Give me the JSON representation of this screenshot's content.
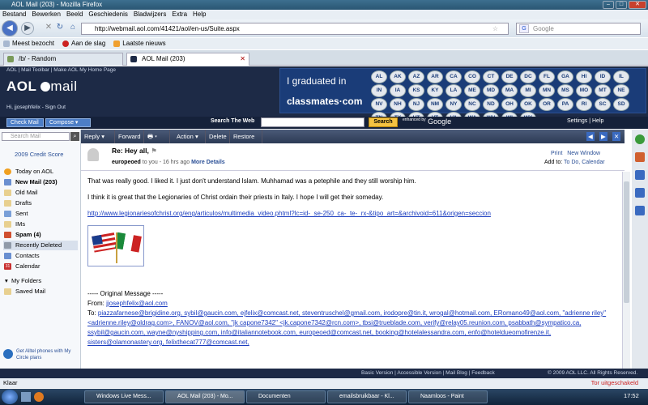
{
  "browser": {
    "title": "AOL Mail (203) - Mozilla Firefox",
    "menu": [
      "Bestand",
      "Bewerken",
      "Beeld",
      "Geschiedenis",
      "Bladwijzers",
      "Extra",
      "Help"
    ],
    "url": "http://webmail.aol.com/41421/aol/en-us/Suite.aspx",
    "search_placeholder": "Google",
    "bookmarks": [
      "Meest bezocht",
      "Aan de slag",
      "Laatste nieuws"
    ],
    "tabs": [
      "/b/ - Random",
      "AOL Mail (203)"
    ]
  },
  "aol": {
    "toplinks": "AOL  |  Mail Toolbar  |  Make AOL My Home Page",
    "logo_a": "AOL",
    "logo_b": "mail",
    "user": "Hi, jjosephfelix  -  Sign Out",
    "ad_line1": "I graduated in",
    "ad_line2": "classmates·com",
    "states": [
      "AL",
      "AK",
      "AZ",
      "AR",
      "CA",
      "CO",
      "CT",
      "DE",
      "DC",
      "FL",
      "GA",
      "HI",
      "ID",
      "IL",
      "IN",
      "IA",
      "KS",
      "KY",
      "LA",
      "ME",
      "MD",
      "MA",
      "MI",
      "MN",
      "MS",
      "MO",
      "MT",
      "NE",
      "NV",
      "NH",
      "NJ",
      "NM",
      "NY",
      "NC",
      "ND",
      "OH",
      "OK",
      "OR",
      "PA",
      "RI",
      "SC",
      "SD",
      "TN",
      "TX",
      "UT",
      "VT",
      "VA",
      "WA",
      "WV",
      "WI",
      "WY"
    ],
    "check_mail": "Check Mail",
    "compose": "Compose",
    "search_web": "Search The Web",
    "search_btn": "Search",
    "google": "Google",
    "google_small": "enhanced by",
    "settings": "Settings  |  Help",
    "footer": "Basic Version  |  Accessible Version  |  Mail Blog  |  Feedback",
    "copyright": "© 2009 AOL LLC. All Rights Reserved."
  },
  "sidebar": {
    "search_placeholder": "Search Mail",
    "credit": "2009 Credit Score",
    "folders": [
      {
        "label": "Today on AOL",
        "bold": false
      },
      {
        "label": "New Mail (203)",
        "bold": true
      },
      {
        "label": "Old Mail",
        "bold": false
      },
      {
        "label": "Drafts",
        "bold": false
      },
      {
        "label": "Sent",
        "bold": false
      },
      {
        "label": "IMs",
        "bold": false
      },
      {
        "label": "Spam (4)",
        "bold": true
      },
      {
        "label": "Recently Deleted",
        "bold": false
      },
      {
        "label": "Contacts",
        "bold": false
      },
      {
        "label": "Calendar",
        "bold": false
      }
    ],
    "my_folders": "My Folders",
    "saved_mail": "Saved Mail",
    "alltel": "Get Alltel phones with My Circle plans"
  },
  "toolbar": [
    "Reply",
    "Forward",
    "",
    "Action",
    "Delete",
    "Restore"
  ],
  "message": {
    "subject": "Re: Hey all,",
    "from": "europeoed",
    "to_you": "to you - 16 hrs ago",
    "more_details": "More Details",
    "print": "Print",
    "new_window": "New Window",
    "add_to": "Add to:",
    "add_to_links": "To Do, Calendar",
    "p1": "That was really good.  I liked it.  I just don't understand Islam.  Muhhamad was a petephile and they still worship him.",
    "p2": "I think it is great that the Legionaries of Christ ordain their priests in Italy.  I hope I will get their someday.",
    "link": "http://www.legionariesofchrist.org/eng/articulos/multimedia_video.phtml?lc=id-_se-250_ca-_te-_rx-&tipo_art=&archivoid=611&origen=seccion",
    "orig": "----- Original Message -----",
    "from_line": "From:",
    "from_addr": "jjosephfelix@aol.com",
    "to_line": "To:",
    "to_addrs": "piazzafarnese@brigidine.org, sybil@gaucin.com, ejfelix@comcast.net, steventruschel@gmail.com, irodopre@tin.it, wrogal@hotmail.com, ERomano49@aol.com, \"adrienne riley\" <adrienne.riley@oldrag.com>, FANOV@aol.com, \"jk capone7342\" <jk.capone7342@rcn.com>, tbsi@trueblade.com, verify@relay05.reunion.com, psabbath@sympatico.ca, ssybil@gaucin.com, wayne@nyshipping.com, info@italiannotebook.com, europeoed@comcast.net, booking@hotelalessandra.com, enfo@hoteldueomofirenze.it, sisters@olamonastery.org, felixthecat777@comcast.net,"
  },
  "status": {
    "left": "Klaar",
    "right": "Tor uitgeschakeld"
  },
  "taskbar": [
    "Windows Live Mess...",
    "AOL Mail (203) - Mo...",
    "Documenten",
    "emailsbruikbaar - Kl...",
    "Naamloos - Paint"
  ],
  "clock": "17:52",
  "colors": {
    "aol_navy": "#1d2a46",
    "accent_blue": "#4d7ec6",
    "link": "#1a3cbf"
  }
}
